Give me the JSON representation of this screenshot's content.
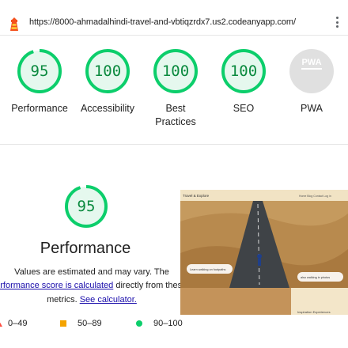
{
  "header": {
    "url": "https://8000-ahmadalhindi-travel-and-vbtiqzrdx7.us2.codeanyapp.com/"
  },
  "scores": [
    {
      "label": "Performance",
      "value": "95",
      "fraction": 0.95
    },
    {
      "label": "Accessibility",
      "value": "100",
      "fraction": 1.0
    },
    {
      "label": "Best Practices",
      "value": "100",
      "fraction": 1.0
    },
    {
      "label": "SEO",
      "value": "100",
      "fraction": 1.0
    },
    {
      "label": "PWA",
      "value": "PWA",
      "fraction": 0
    }
  ],
  "performance": {
    "score": "95",
    "fraction": 0.95,
    "title": "Performance",
    "note_line1": "Values are estimated and may vary. The",
    "note_link1": "performance score is calculated",
    "note_line2_rest": " directly from these",
    "note_line3_pre": "metrics. ",
    "note_link2": "See calculator."
  },
  "screenshot": {
    "brand": "Travel & Explore",
    "nav": "Home   Blog   Contact   Log in",
    "bubble1": "Learn walking on footpaths",
    "bubble2": "also walking in photos",
    "footer": "Inspiration Experiences"
  },
  "legend": {
    "red": "0–49",
    "orange": "50–89",
    "green": "90–100"
  },
  "colors": {
    "pass": "#0cce6b",
    "pass_text": "#0b8a3f",
    "pass_fill": "#e5f8ee",
    "average": "#f4a300",
    "fail": "#ff4e42",
    "pwa_gray": "#e0e0e0"
  },
  "icons": {
    "logo": "lighthouse-icon",
    "menu": "kebab-menu-icon"
  }
}
